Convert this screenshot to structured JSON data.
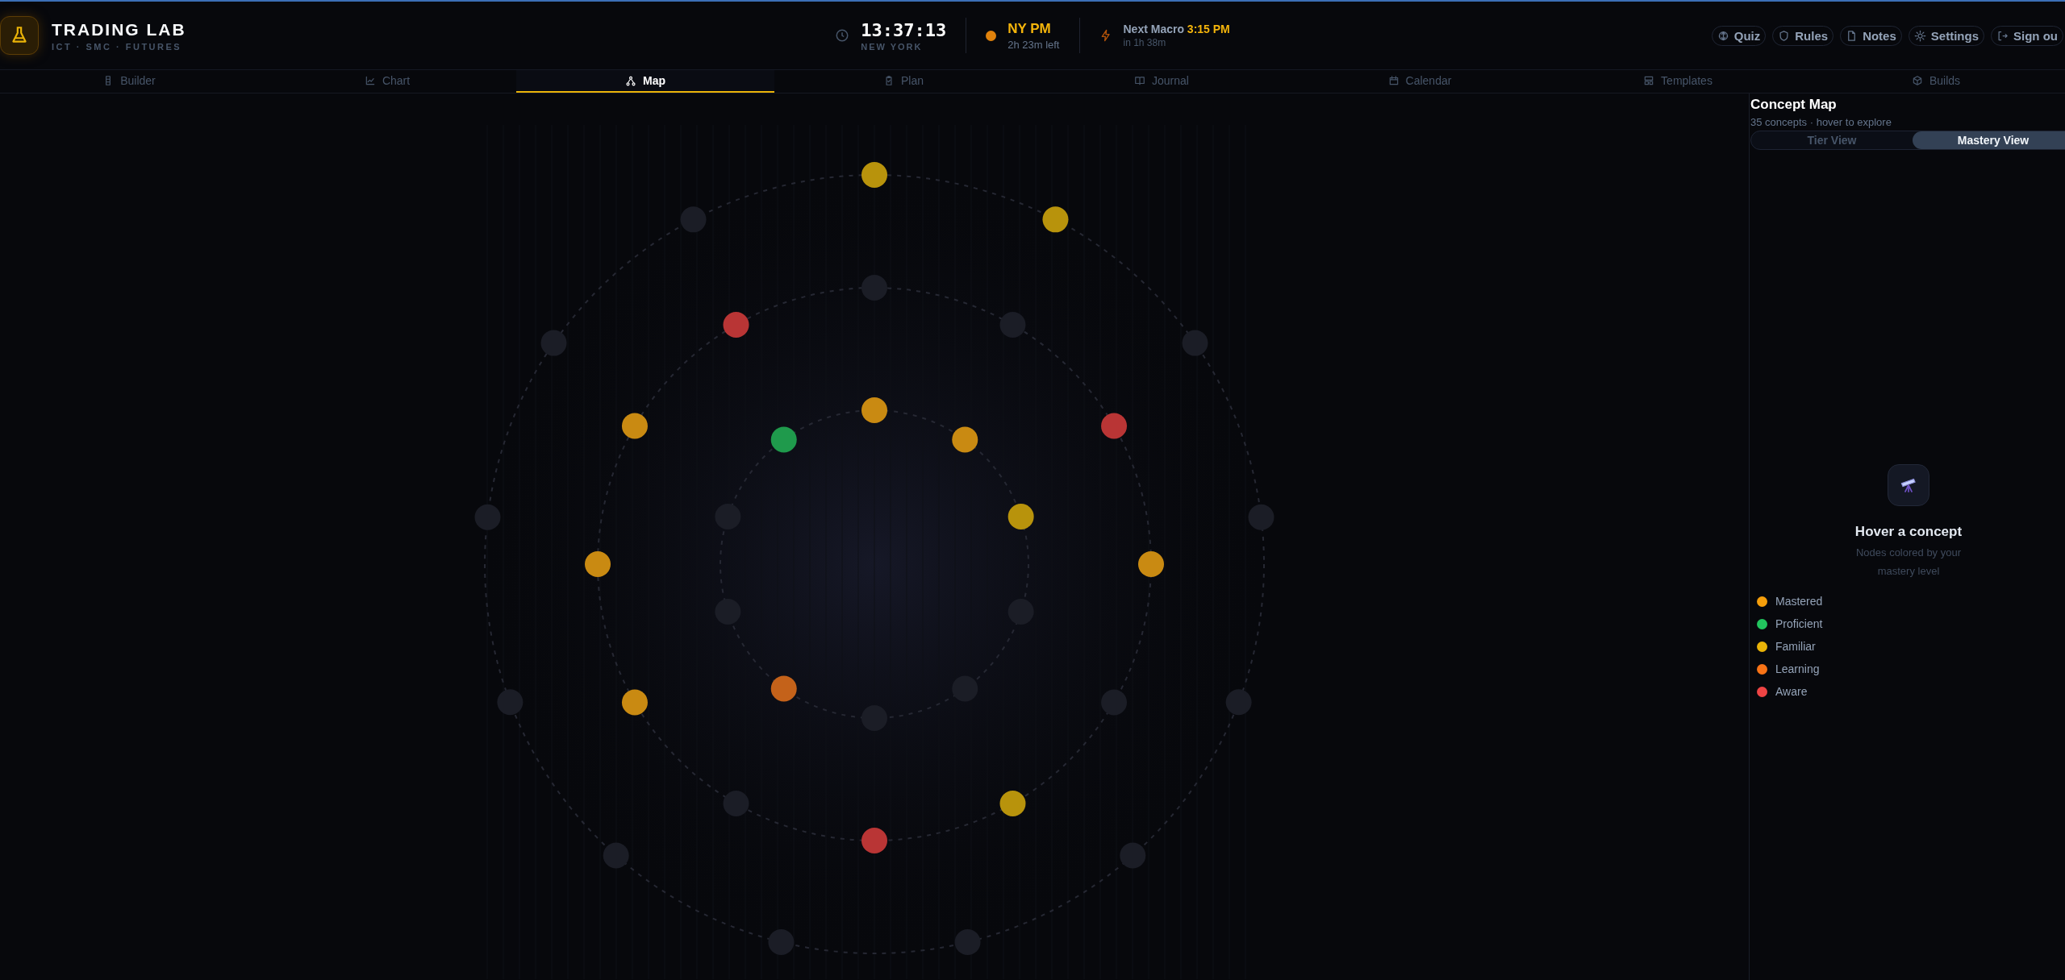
{
  "header": {
    "brand": {
      "title": "TRADING LAB",
      "subtitle": "ICT · SMC · FUTURES"
    },
    "clock": {
      "time": "13:37:13",
      "zone": "NEW YORK"
    },
    "session": {
      "name": "NY PM",
      "remaining": "2h 23m left"
    },
    "macro": {
      "label": "Next Macro",
      "time": "3:15 PM",
      "countdown": "in 1h 38m"
    },
    "actions": [
      {
        "kind": "quiz",
        "label": "Quiz"
      },
      {
        "kind": "rules",
        "label": "Rules"
      },
      {
        "kind": "notes",
        "label": "Notes"
      },
      {
        "kind": "settings",
        "label": "Settings"
      },
      {
        "kind": "signout",
        "label": "Sign ou"
      }
    ]
  },
  "tabs": [
    {
      "kind": "builder",
      "label": "Builder",
      "selected": false
    },
    {
      "kind": "chart",
      "label": "Chart",
      "selected": false
    },
    {
      "kind": "map",
      "label": "Map",
      "selected": true
    },
    {
      "kind": "plan",
      "label": "Plan",
      "selected": false
    },
    {
      "kind": "journal",
      "label": "Journal",
      "selected": false
    },
    {
      "kind": "calendar",
      "label": "Calendar",
      "selected": false
    },
    {
      "kind": "templates",
      "label": "Templates",
      "selected": false
    },
    {
      "kind": "builds",
      "label": "Builds",
      "selected": false
    }
  ],
  "map": {
    "rings": [
      {
        "nodes": [
          {
            "color": "#c98a12"
          },
          {
            "color": "#c98a12"
          },
          {
            "color": "#b8930c"
          },
          {
            "color": "#1b1d26"
          },
          {
            "color": "#1b1d26"
          },
          {
            "color": "#1b1d26"
          },
          {
            "color": "#c4621a"
          },
          {
            "color": "#1b1d26"
          },
          {
            "color": "#1b1d26"
          },
          {
            "color": "#1f9a4c"
          }
        ]
      },
      {
        "nodes": [
          {
            "color": "#1b1d26"
          },
          {
            "color": "#1b1d26"
          },
          {
            "color": "#b93535"
          },
          {
            "color": "#c98a12"
          },
          {
            "color": "#1b1d26"
          },
          {
            "color": "#b8930c"
          },
          {
            "color": "#b93535"
          },
          {
            "color": "#1b1d26"
          },
          {
            "color": "#c98a12"
          },
          {
            "color": "#c98a12"
          },
          {
            "color": "#c98a12"
          },
          {
            "color": "#b93535"
          }
        ]
      },
      {
        "nodes": [
          {
            "color": "#b8930c"
          },
          {
            "color": "#b8930c"
          },
          {
            "color": "#1b1d26"
          },
          {
            "color": "#1b1d26"
          },
          {
            "color": "#1b1d26"
          },
          {
            "color": "#1b1d26"
          },
          {
            "color": "#1b1d26"
          },
          {
            "color": "#1b1d26"
          },
          {
            "color": "#1b1d26"
          },
          {
            "color": "#1b1d26"
          },
          {
            "color": "#1b1d26"
          },
          {
            "color": "#1b1d26"
          },
          {
            "color": "#1b1d26"
          }
        ]
      }
    ]
  },
  "panel": {
    "title": "Concept Map",
    "subtitle": "35 concepts · hover to explore",
    "view_toggle": [
      {
        "label": "Tier View",
        "selected": false
      },
      {
        "label": "Mastery View",
        "selected": true
      }
    ],
    "empty_state": {
      "title": "Hover a concept",
      "hint": "Nodes colored by your mastery level"
    },
    "legend": [
      {
        "label": "Mastered",
        "color": "#f59e0b"
      },
      {
        "label": "Proficient",
        "color": "#22c55e"
      },
      {
        "label": "Familiar",
        "color": "#eab308"
      },
      {
        "label": "Learning",
        "color": "#f97316"
      },
      {
        "label": "Aware",
        "color": "#ef4444"
      }
    ]
  }
}
